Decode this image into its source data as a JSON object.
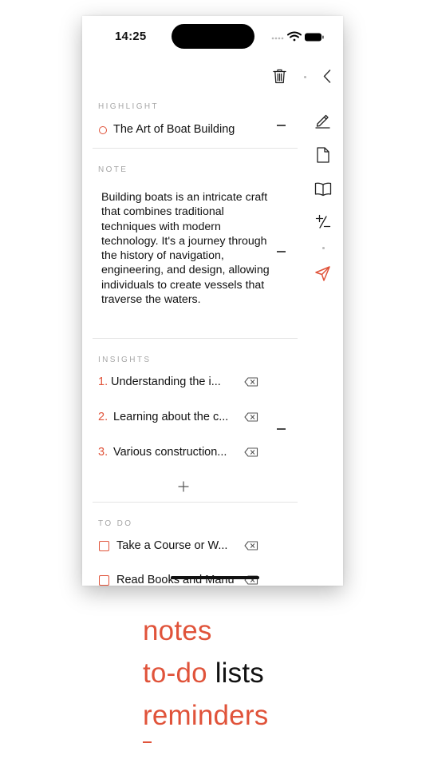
{
  "status_bar": {
    "time": "14:25"
  },
  "icons": {
    "trash": "trash-icon",
    "back": "chevron-left-icon",
    "edit": "pencil-icon",
    "document": "document-icon",
    "book": "book-icon",
    "plusminus": "plus-minus-icon",
    "send": "paper-plane-icon",
    "delete": "delete-backward-icon",
    "add": "plus-icon"
  },
  "highlight": {
    "label": "HIGHLIGHT",
    "text": "The Art of Boat Building"
  },
  "note": {
    "label": "NOTE",
    "text": "Building boats is an intricate craft that combines traditional techniques with modern technology. It's a journey through the history of navigation, engineering, and design, allowing individuals to create vessels that traverse the waters."
  },
  "insights": {
    "label": "INSIGHTS",
    "items": [
      {
        "number": "1.",
        "text": "Understanding the i..."
      },
      {
        "number": "2.",
        "text": "Learning about the c..."
      },
      {
        "number": "3.",
        "text": "Various construction..."
      }
    ]
  },
  "todo": {
    "label": "TO DO",
    "items": [
      {
        "text": "Take a Course or W..."
      },
      {
        "text": "Read Books and Manu"
      }
    ]
  },
  "caption": {
    "line1": "notes",
    "line2_accent": "to-do",
    "line2_rest": " lists",
    "line3": "reminders"
  },
  "colors": {
    "accent": "#e0533a",
    "text": "#111111",
    "muted": "#a6a6a6"
  }
}
